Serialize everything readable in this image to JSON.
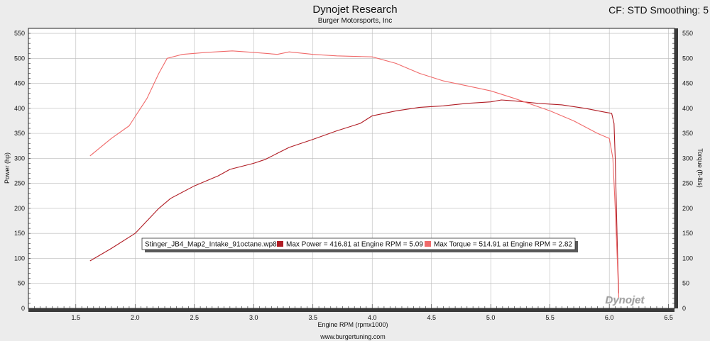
{
  "header": {
    "title": "Dynojet Research",
    "subtitle": "Burger Motorsports, Inc",
    "settings": "CF: STD Smoothing: 5"
  },
  "footer": {
    "url": "www.burgertuning.com",
    "watermark": "Dynojet"
  },
  "colors": {
    "power": "#b01c24",
    "torque": "#f06a6a",
    "plot_bg": "#ffffff",
    "page_bg": "#ececec"
  },
  "chart_data": {
    "type": "line",
    "xlabel": "Engine RPM (rpmx1000)",
    "ylabel": "Power (hp)",
    "y2label": "Torque (ft-lbs)",
    "xlim": [
      1.1,
      6.55
    ],
    "ylim": [
      0,
      560
    ],
    "y2lim": [
      0,
      560
    ],
    "xticks": [
      "1.5",
      "2.0",
      "2.5",
      "3.0",
      "3.5",
      "4.0",
      "4.5",
      "5.0",
      "5.5",
      "6.0",
      "6.5"
    ],
    "yticks": [
      "0",
      "50",
      "100",
      "150",
      "200",
      "250",
      "300",
      "350",
      "400",
      "450",
      "500",
      "550"
    ],
    "y2ticks": [
      "0",
      "50",
      "100",
      "150",
      "200",
      "250",
      "300",
      "350",
      "400",
      "450",
      "500",
      "550"
    ],
    "grid": true,
    "legend": {
      "run_name": "Stinger_JB4_Map2_Intake_91octane.wp8",
      "power_text": "Max Power = 416.81 at Engine RPM = 5.09",
      "torque_text": "Max Torque = 514.91 at Engine RPM = 2.82",
      "placement": "lower-left"
    },
    "series": [
      {
        "axis": "left",
        "color": "#b01c24",
        "x": [
          1.62,
          1.8,
          2.0,
          2.1,
          2.2,
          2.3,
          2.5,
          2.7,
          2.8,
          3.0,
          3.1,
          3.2,
          3.3,
          3.5,
          3.7,
          3.9,
          4.0,
          4.2,
          4.4,
          4.6,
          4.8,
          5.0,
          5.09,
          5.2,
          5.4,
          5.6,
          5.8,
          5.95,
          6.02,
          6.04,
          6.05,
          6.06,
          6.07,
          6.08
        ],
        "values": [
          95,
          120,
          150,
          175,
          200,
          220,
          245,
          265,
          278,
          290,
          298,
          310,
          322,
          338,
          355,
          370,
          385,
          395,
          402,
          405,
          410,
          413,
          416.81,
          415,
          410,
          407,
          400,
          393,
          390,
          370,
          300,
          200,
          100,
          30
        ]
      },
      {
        "axis": "right",
        "color": "#f06a6a",
        "x": [
          1.62,
          1.8,
          1.95,
          2.1,
          2.2,
          2.27,
          2.4,
          2.6,
          2.82,
          3.0,
          3.2,
          3.3,
          3.5,
          3.7,
          4.0,
          4.2,
          4.4,
          4.6,
          4.8,
          5.0,
          5.2,
          5.5,
          5.7,
          5.9,
          6.0,
          6.03,
          6.05,
          6.07,
          6.08
        ],
        "values": [
          305,
          340,
          365,
          420,
          470,
          500,
          508,
          512,
          514.91,
          512,
          508,
          513,
          508,
          505,
          503,
          490,
          470,
          455,
          445,
          435,
          420,
          395,
          375,
          350,
          340,
          300,
          200,
          80,
          20
        ]
      }
    ]
  }
}
